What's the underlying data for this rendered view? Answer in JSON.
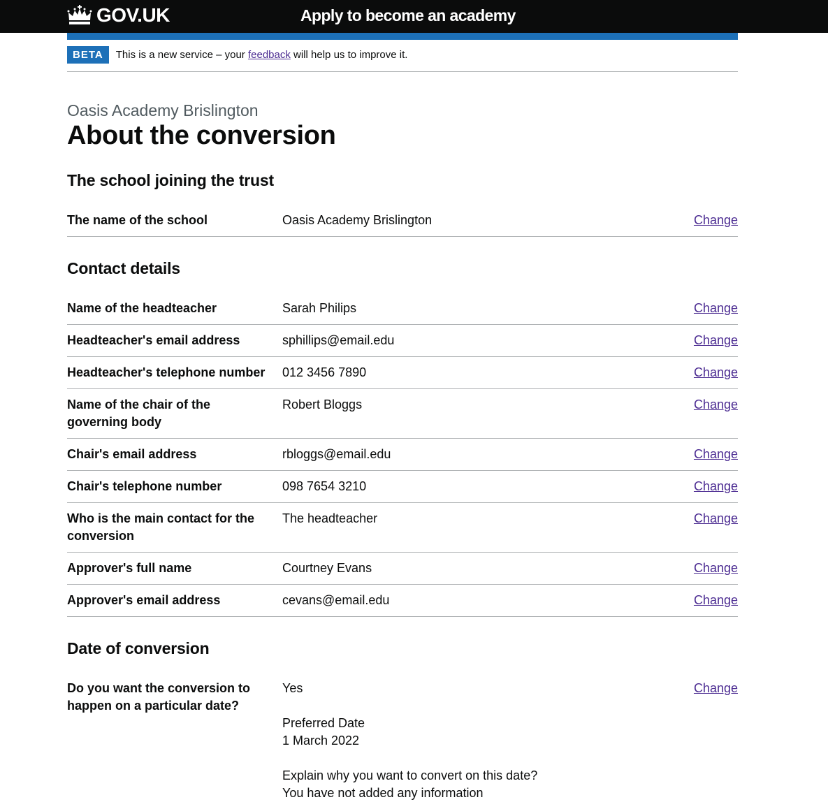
{
  "header": {
    "logo_text": "GOV.UK",
    "service_name": "Apply to become an academy"
  },
  "phase_banner": {
    "tag": "BETA",
    "text_before": "This is a new service – your ",
    "link": "feedback",
    "text_after": " will help us to improve it."
  },
  "page": {
    "caption": "Oasis Academy Brislington",
    "title": "About the conversion"
  },
  "colors": {
    "header_bg": "#0b0c0c",
    "brand_blue": "#1d70b8",
    "visited_link": "#4c2c92",
    "secondary_text": "#505a5f",
    "border": "#b1b4b6"
  },
  "sections": [
    {
      "heading": "The school joining the trust",
      "rows": [
        {
          "key": "The name of the school",
          "value": "Oasis Academy Brislington",
          "action": "Change"
        }
      ]
    },
    {
      "heading": "Contact details",
      "rows": [
        {
          "key": "Name of the headteacher",
          "value": "Sarah Philips",
          "action": "Change"
        },
        {
          "key": "Headteacher's email address",
          "value": "sphillips@email.edu",
          "action": "Change"
        },
        {
          "key": "Headteacher's telephone number",
          "value": "012 3456 7890",
          "action": "Change"
        },
        {
          "key": "Name of the chair of the governing body",
          "value": "Robert Bloggs",
          "action": "Change"
        },
        {
          "key": "Chair's email address",
          "value": "rbloggs@email.edu",
          "action": "Change"
        },
        {
          "key": "Chair's telephone number",
          "value": "098 7654 3210",
          "action": "Change"
        },
        {
          "key": "Who is the main contact for the conversion",
          "value": "The headteacher",
          "action": "Change"
        },
        {
          "key": "Approver's full name",
          "value": "Courtney Evans",
          "action": "Change"
        },
        {
          "key": "Approver's email address",
          "value": "cevans@email.edu",
          "action": "Change"
        }
      ]
    },
    {
      "heading": "Date of conversion",
      "rows": [
        {
          "key": "Do you want the conversion to happen on a particular date?",
          "value": "Yes",
          "preferred_date_label": "Preferred Date",
          "preferred_date": "1 March 2022",
          "explain_label": "Explain why you want to convert on this date?",
          "explain_value": "You have not added any information",
          "action": "Change"
        }
      ]
    }
  ]
}
